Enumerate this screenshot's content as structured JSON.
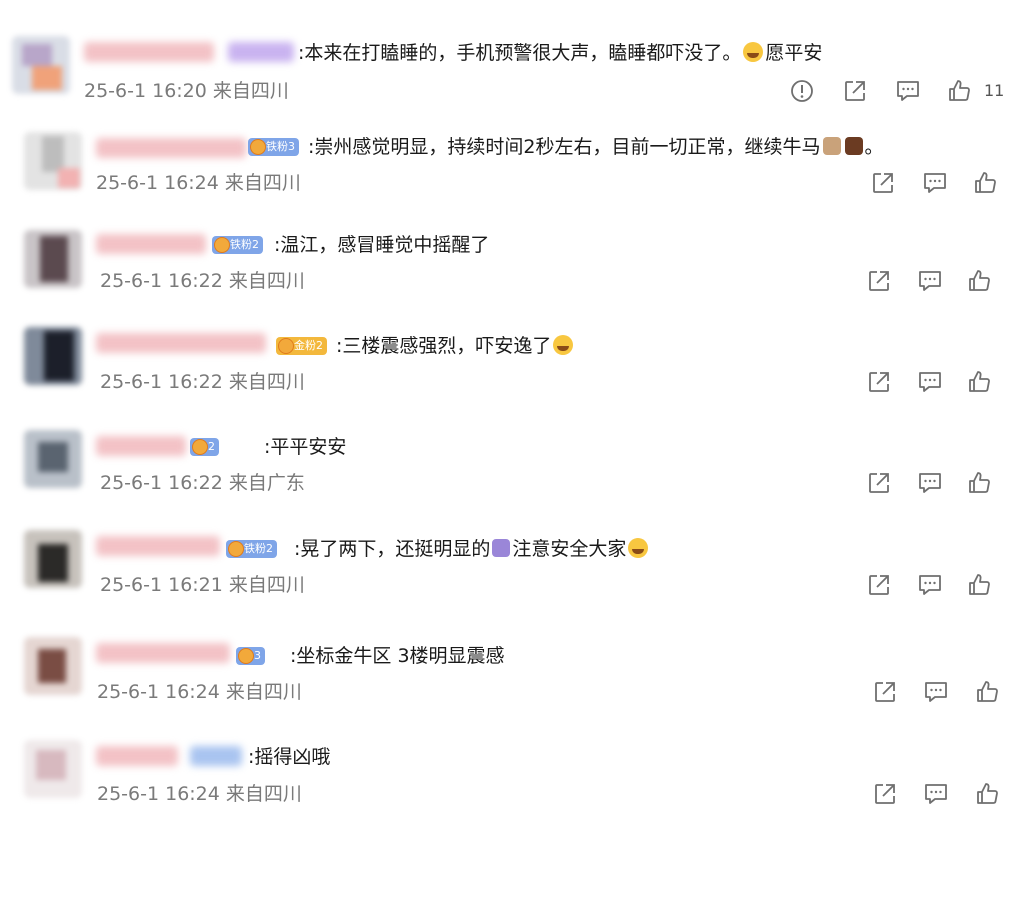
{
  "comments": [
    {
      "text": ":本来在打瞌睡的，手机预警很大声，瞌睡都吓没了。",
      "emoji_after": "crying-face",
      "text_tail": "愿平安",
      "time": "25-6-1 16:20 来自四川",
      "likes": "11",
      "badge": ""
    },
    {
      "text": ":崇州感觉明显，持续时间2秒左右，目前一切正常，继续牛马",
      "emoji_after": "cow-horse",
      "text_tail": "。",
      "time": "25-6-1 16:24 来自四川",
      "badge": "铁粉3"
    },
    {
      "text": ":温江，感冒睡觉中摇醒了",
      "time": "25-6-1 16:22 来自四川",
      "badge": "铁粉2"
    },
    {
      "text": ":三楼震感强烈，吓安逸了",
      "emoji_after": "laughing-tears",
      "time": "25-6-1 16:22 来自四川",
      "badge": "金粉2"
    },
    {
      "text": ":平平安安",
      "time": "25-6-1 16:22 来自广东",
      "badge": "2"
    },
    {
      "text": ":晃了两下，还挺明显的",
      "emoji_mid": "praying-hands",
      "text_tail": "注意安全大家",
      "emoji_after": "heart-face",
      "time": "25-6-1 16:21 来自四川",
      "badge": "铁粉2"
    },
    {
      "text": ":坐标金牛区 3楼明显震感",
      "time": "25-6-1 16:24 来自四川",
      "badge": "3"
    },
    {
      "text": ":摇得凶哦",
      "time": "25-6-1 16:24 来自四川",
      "badge": ""
    }
  ],
  "colors": {
    "text": "#1a1a1a",
    "meta": "#7a7a7a",
    "icon": "#6f6f6f",
    "iron_badge": "#7fa5e8",
    "gold_badge": "#f3b83c"
  },
  "icons": {
    "report": "exclamation-circle-icon",
    "share": "share-icon",
    "comment": "comment-icon",
    "like": "thumbs-up-icon"
  }
}
